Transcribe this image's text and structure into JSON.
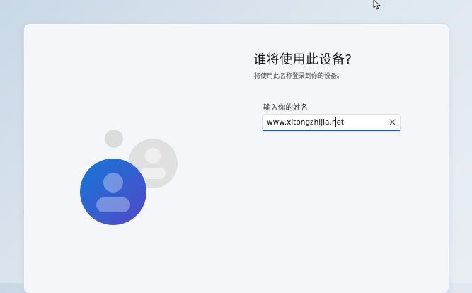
{
  "dialog": {
    "title": "谁将使用此设备?",
    "subtitle": "将使用此名称登录到你的设备。",
    "field_label": "输入你的姓名",
    "name_value": "www.xitongzhijia.net"
  },
  "icons": {
    "mouse_cursor": "mouse-pointer-icon",
    "clear": "close-icon",
    "main_avatar": "user-avatar-icon",
    "secondary_avatar": "user-avatar-icon"
  },
  "colors": {
    "accent": "#1a5fb4",
    "avatar_gradient_start": "#1577d6",
    "avatar_gradient_end": "#5148c9",
    "placeholder_avatar": "#dcdcdc",
    "dialog_background": "#f4f6f9"
  }
}
